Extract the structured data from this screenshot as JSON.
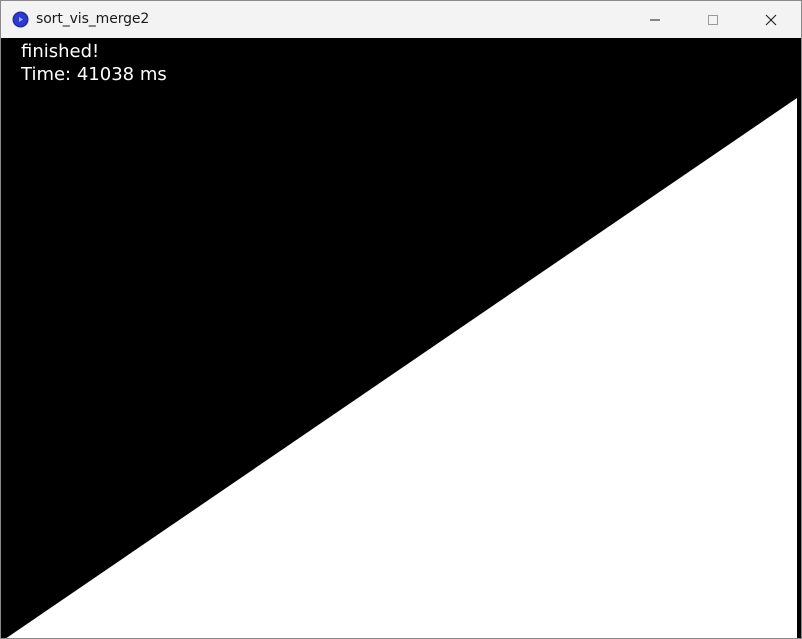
{
  "window": {
    "title": "sort_vis_merge2",
    "icon": "processing-app-icon",
    "controls": [
      "minimize-icon",
      "maximize-icon",
      "close-icon"
    ]
  },
  "canvas": {
    "status_line": "finished!",
    "time_line": "Time: 41038 ms",
    "background_color": "#000000",
    "bar_color": "#ffffff",
    "sorted": true
  }
}
